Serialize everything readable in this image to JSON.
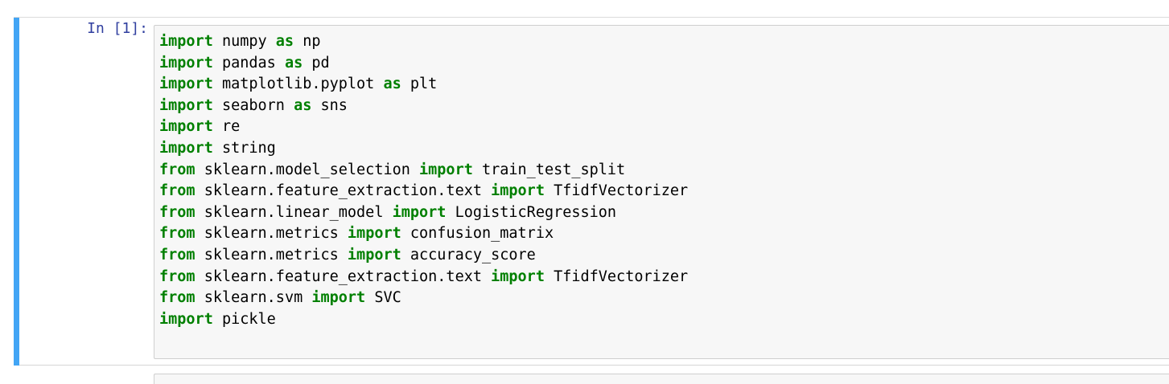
{
  "cell": {
    "prompt": "In [1]:",
    "lines": [
      [
        {
          "t": "import",
          "kw": true
        },
        {
          "t": " numpy "
        },
        {
          "t": "as",
          "kw": true
        },
        {
          "t": " np"
        }
      ],
      [
        {
          "t": "import",
          "kw": true
        },
        {
          "t": " pandas "
        },
        {
          "t": "as",
          "kw": true
        },
        {
          "t": " pd"
        }
      ],
      [
        {
          "t": "import",
          "kw": true
        },
        {
          "t": " matplotlib.pyplot "
        },
        {
          "t": "as",
          "kw": true
        },
        {
          "t": " plt"
        }
      ],
      [
        {
          "t": "import",
          "kw": true
        },
        {
          "t": " seaborn "
        },
        {
          "t": "as",
          "kw": true
        },
        {
          "t": " sns"
        }
      ],
      [
        {
          "t": "import",
          "kw": true
        },
        {
          "t": " re"
        }
      ],
      [
        {
          "t": "import",
          "kw": true
        },
        {
          "t": " string"
        }
      ],
      [
        {
          "t": "from",
          "kw": true
        },
        {
          "t": " sklearn.model_selection "
        },
        {
          "t": "import",
          "kw": true
        },
        {
          "t": " train_test_split"
        }
      ],
      [
        {
          "t": "from",
          "kw": true
        },
        {
          "t": " sklearn.feature_extraction.text "
        },
        {
          "t": "import",
          "kw": true
        },
        {
          "t": " TfidfVectorizer"
        }
      ],
      [
        {
          "t": "from",
          "kw": true
        },
        {
          "t": " sklearn.linear_model "
        },
        {
          "t": "import",
          "kw": true
        },
        {
          "t": " LogisticRegression"
        }
      ],
      [
        {
          "t": "from",
          "kw": true
        },
        {
          "t": " sklearn.metrics "
        },
        {
          "t": "import",
          "kw": true
        },
        {
          "t": " confusion_matrix"
        }
      ],
      [
        {
          "t": "from",
          "kw": true
        },
        {
          "t": " sklearn.metrics "
        },
        {
          "t": "import",
          "kw": true
        },
        {
          "t": " accuracy_score"
        }
      ],
      [
        {
          "t": "from",
          "kw": true
        },
        {
          "t": " sklearn.feature_extraction.text "
        },
        {
          "t": "import",
          "kw": true
        },
        {
          "t": " TfidfVectorizer"
        }
      ],
      [
        {
          "t": "from",
          "kw": true
        },
        {
          "t": " sklearn.svm "
        },
        {
          "t": "import",
          "kw": true
        },
        {
          "t": " SVC"
        }
      ],
      [
        {
          "t": "import",
          "kw": true
        },
        {
          "t": " pickle"
        }
      ]
    ]
  },
  "colors": {
    "selected_bar": "#42a5f5",
    "prompt": "#303f9f",
    "keyword": "#008000",
    "editor_bg": "#f7f7f7"
  }
}
